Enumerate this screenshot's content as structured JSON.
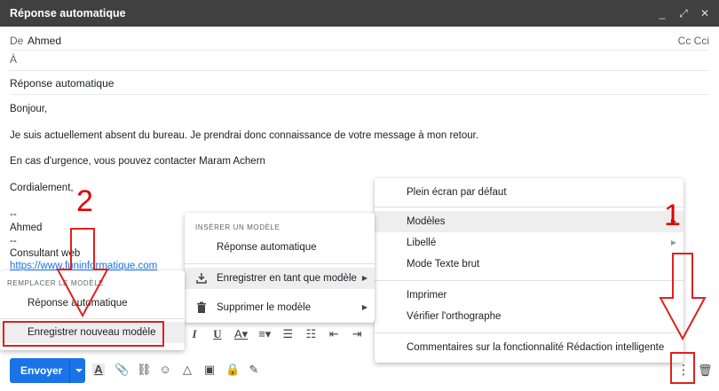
{
  "window": {
    "title": "Réponse automatique",
    "controls": [
      "_",
      "⤢",
      "✕"
    ]
  },
  "compose": {
    "from_label": "De",
    "from_value": "Ahmed",
    "cc_label": "Cc Cci",
    "to_label": "À",
    "subject": "Réponse automatique",
    "body": [
      "Bonjour,",
      "Je suis actuellement absent du bureau. Je prendrai donc connaissance de votre message à mon retour.",
      "En cas d'urgence, vous pouvez contacter Maram Achern",
      "Cordialement,",
      "--",
      "Ahmed",
      "--",
      "Consultant web",
      "https://www.funinformatique.com"
    ]
  },
  "menu_main": {
    "items": [
      "Plein écran par défaut",
      "Modèles",
      "Libellé",
      "Mode Texte brut",
      "Imprimer",
      "Vérifier l'orthographe",
      "Commentaires sur la fonctionnalité Rédaction intelligente"
    ]
  },
  "menu_templates": {
    "heading": "Insérer un modèle",
    "items": [
      "Réponse automatique",
      "Enregistrer en tant que modèle",
      "Supprimer le modèle"
    ]
  },
  "menu_save": {
    "heading": "Remplacer le modèle",
    "items": [
      "Réponse automatique",
      "Enregistrer nouveau modèle"
    ]
  },
  "toolbar": {
    "send_label": "Envoyer"
  },
  "annotations": {
    "step1": "1",
    "step2": "2",
    "color": "#e00000"
  }
}
